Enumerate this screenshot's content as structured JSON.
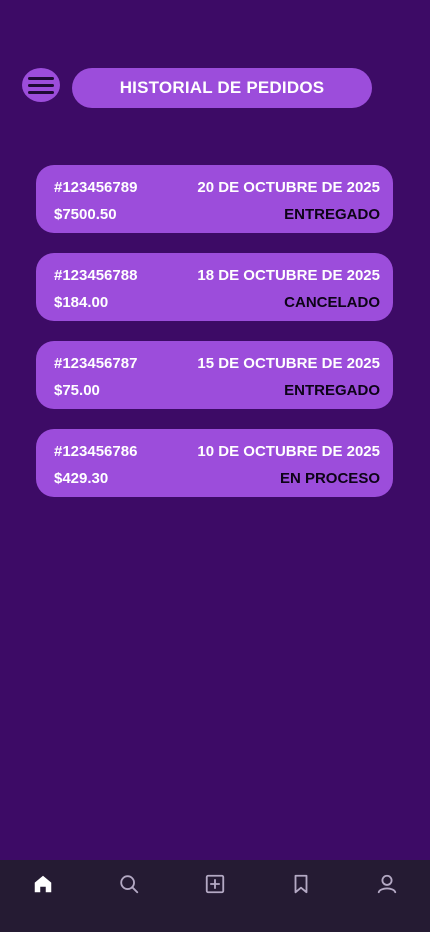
{
  "header": {
    "title": "HISTORIAL DE PEDIDOS",
    "menu_icon": "hamburger-menu-icon"
  },
  "orders": [
    {
      "id": "#123456789",
      "date": "20 DE OCTUBRE DE 2025",
      "total": "$7500.50",
      "status": "ENTREGADO"
    },
    {
      "id": "#123456788",
      "date": "18 DE OCTUBRE DE 2025",
      "total": "$184.00",
      "status": "CANCELADO"
    },
    {
      "id": "#123456787",
      "date": "15 DE OCTUBRE DE 2025",
      "total": "$75.00",
      "status": "ENTREGADO"
    },
    {
      "id": "#123456786",
      "date": "10 DE OCTUBRE DE 2025",
      "total": "$429.30",
      "status": "EN PROCESO"
    }
  ],
  "bottom_nav": {
    "items": [
      {
        "icon": "home-icon",
        "active": true
      },
      {
        "icon": "search-icon",
        "active": false
      },
      {
        "icon": "add-square-icon",
        "active": false
      },
      {
        "icon": "bookmark-icon",
        "active": false
      },
      {
        "icon": "profile-icon",
        "active": false
      }
    ]
  },
  "colors": {
    "background": "#3d0b66",
    "accent": "#9c4ddb",
    "nav_background": "#251b33",
    "text_light": "#ffffff",
    "text_dark": "#0d0317"
  }
}
